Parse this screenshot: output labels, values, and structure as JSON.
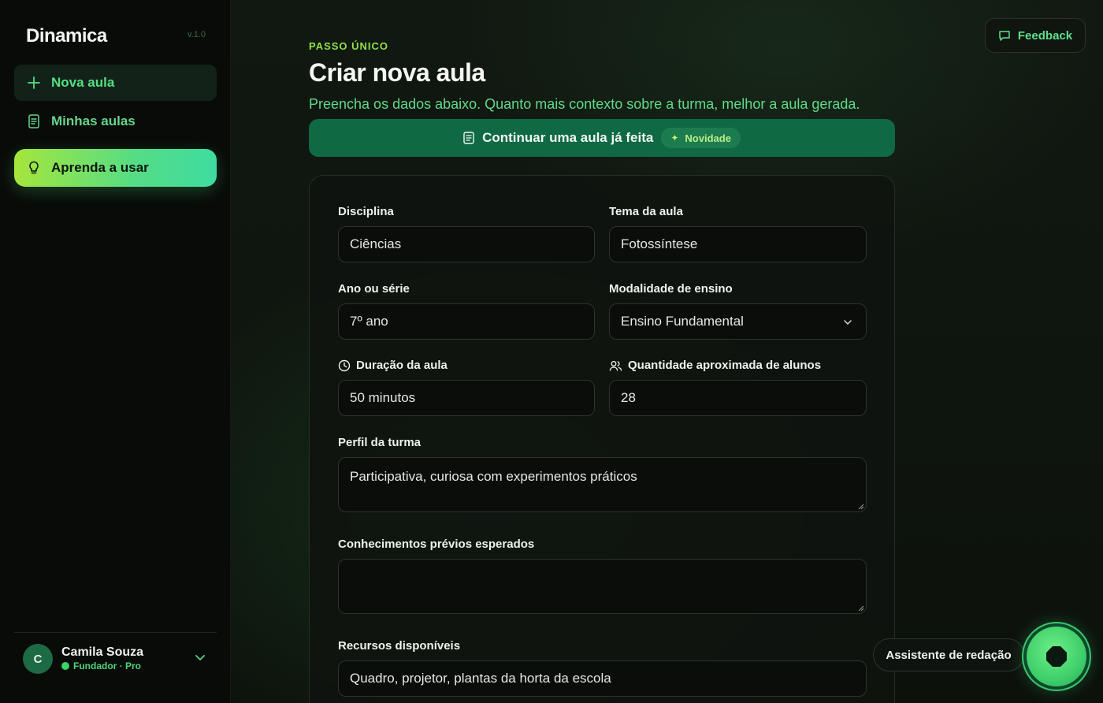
{
  "sidebar": {
    "brand": "Dinamica",
    "version": "v.1.0",
    "items": [
      {
        "label": "Nova aula",
        "icon": "plus-icon"
      },
      {
        "label": "Minhas aulas",
        "icon": "document-icon"
      },
      {
        "label": "Aprenda a usar",
        "icon": "lightbulb-icon"
      }
    ],
    "user": {
      "initial": "C",
      "name": "Camila Souza",
      "role": "Fundador · Pro"
    }
  },
  "header": {
    "feedback_label": "Feedback",
    "eyebrow": "PASSO ÚNICO",
    "title": "Criar nova aula",
    "subtitle": "Preencha os dados abaixo. Quanto mais contexto sobre a turma, melhor a aula gerada.",
    "continue_label": "Continuar uma aula já feita",
    "badge": "Novidade"
  },
  "form": {
    "disciplina": {
      "label": "Disciplina",
      "value": "Ciências"
    },
    "tema": {
      "label": "Tema da aula",
      "value": "Fotossíntese"
    },
    "ano": {
      "label": "Ano ou série",
      "value": "7º ano"
    },
    "modalidade": {
      "label": "Modalidade de ensino",
      "value": "Ensino Fundamental"
    },
    "duracao": {
      "label": "Duração da aula",
      "value": "50 minutos"
    },
    "alunos": {
      "label": "Quantidade aproximada de alunos",
      "value": "28"
    },
    "perfil": {
      "label": "Perfil da turma",
      "value": "Participativa, curiosa com experimentos práticos"
    },
    "conhecimentos": {
      "label": "Conhecimentos prévios esperados",
      "value": ""
    },
    "recursos": {
      "label": "Recursos disponíveis",
      "value": "Quadro, projetor, plantas da horta da escola"
    }
  },
  "assistant": {
    "label": "Assistente de redação"
  },
  "colors": {
    "accent": "#52e083",
    "primary_button": "#0f6a44",
    "background": "#0c0f0c"
  }
}
